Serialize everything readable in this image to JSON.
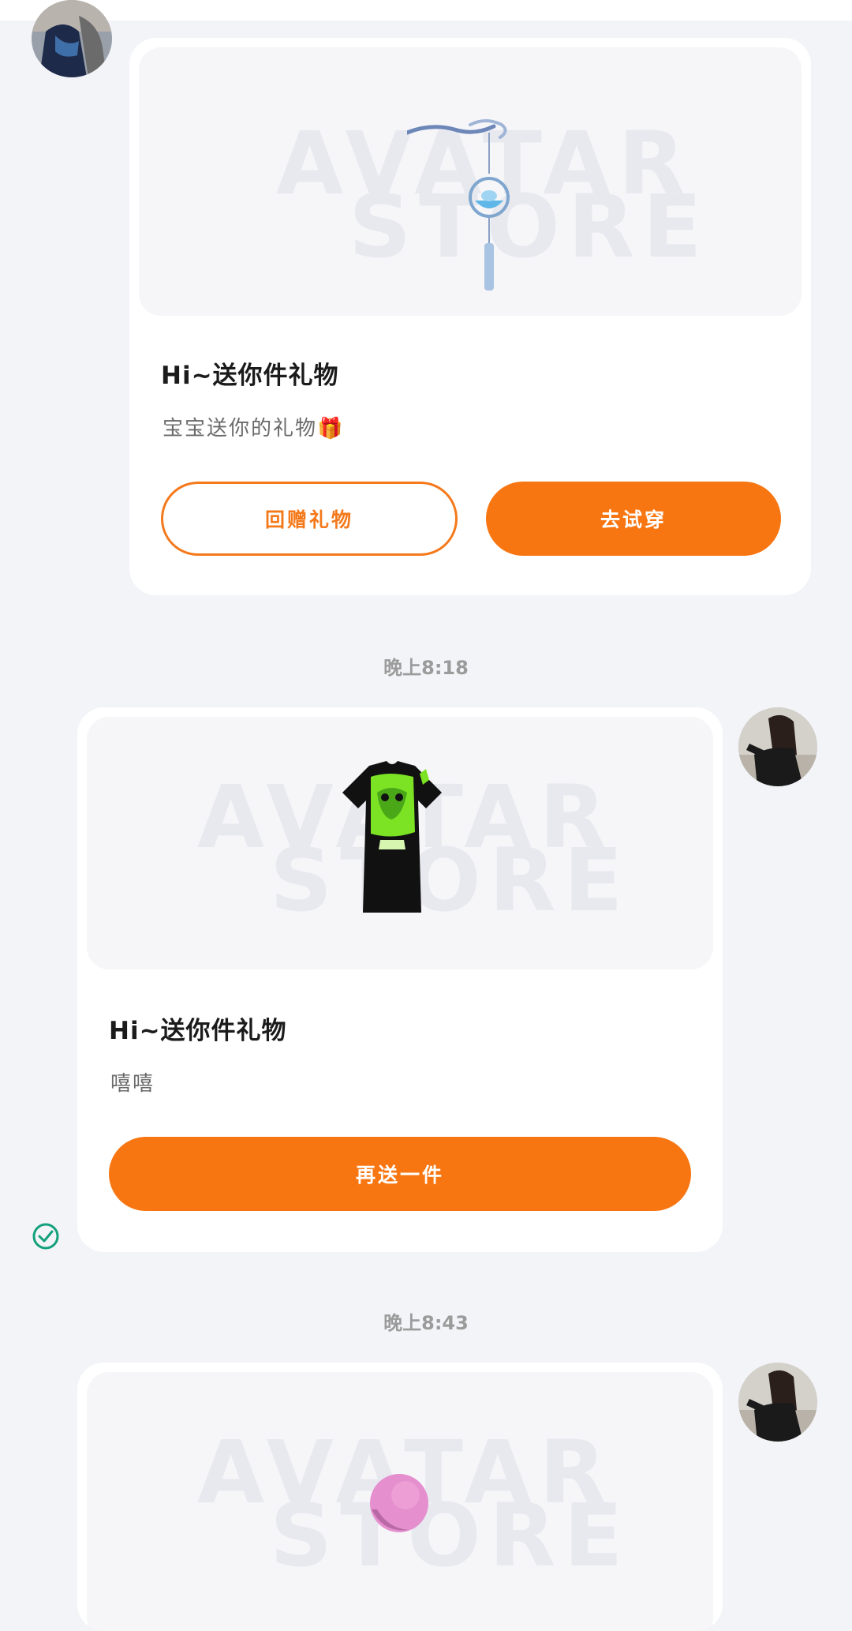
{
  "messages": [
    {
      "title": "Hi~送你件礼物",
      "message": "宝宝送你的礼物🎁",
      "buttons": [
        "回赠礼物",
        "去试穿"
      ],
      "watermark": [
        "AVATAR",
        "STORE"
      ],
      "item_icon": "wind-chime-icon"
    },
    {
      "timestamp": "晚上8:18",
      "title": "Hi~送你件礼物",
      "message": "嘻嘻",
      "buttons": [
        "再送一件"
      ],
      "watermark": [
        "AVATAR",
        "STORE"
      ],
      "item_icon": "black-tshirt-dress-icon",
      "status_icon": "check-circle-icon"
    },
    {
      "timestamp": "晚上8:43",
      "watermark": [
        "AVATAR",
        "STORE"
      ],
      "item_icon": "pink-ball-icon"
    }
  ],
  "colors": {
    "accent": "#f87612",
    "background": "#f3f4f8",
    "status_ok": "#13a07c"
  }
}
